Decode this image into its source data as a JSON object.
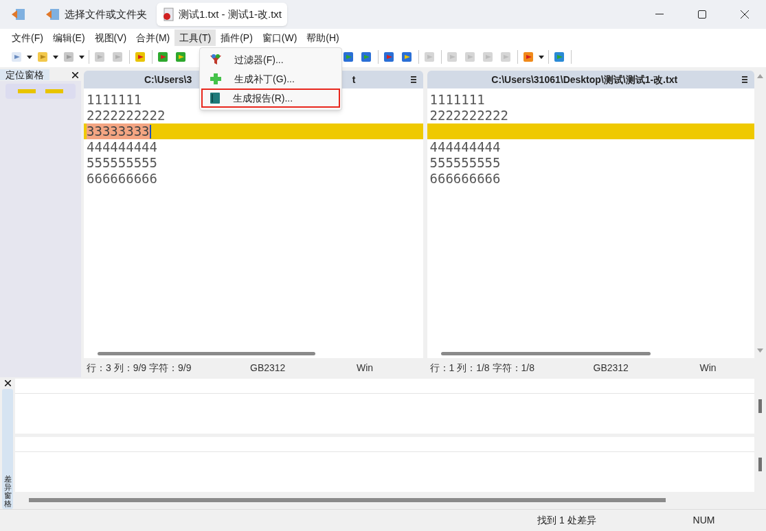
{
  "window": {
    "tabs": [
      {
        "label": "选择文件或文件夹",
        "selected": false
      },
      {
        "label": "测试1.txt - 测试1-改.txt",
        "selected": true
      }
    ]
  },
  "menu": [
    {
      "label": "文件(F)",
      "open": false
    },
    {
      "label": "编辑(E)",
      "open": false
    },
    {
      "label": "视图(V)",
      "open": false
    },
    {
      "label": "合并(M)",
      "open": false
    },
    {
      "label": "工具(T)",
      "open": true
    },
    {
      "label": "插件(P)",
      "open": false
    },
    {
      "label": "窗口(W)",
      "open": false
    },
    {
      "label": "帮助(H)",
      "open": false
    }
  ],
  "dropdown": {
    "items": [
      {
        "label": "过滤器(F)...",
        "kind": "filter",
        "marked": false
      },
      {
        "label": "生成补丁(G)...",
        "kind": "patch",
        "marked": false
      },
      {
        "label": "生成报告(R)...",
        "kind": "report",
        "marked": true
      }
    ]
  },
  "location_pane": {
    "title": "定位窗格"
  },
  "panes": [
    {
      "path": "C:\\Users\\3",
      "path_tail": "t",
      "lines": [
        {
          "text": "1111111",
          "diff": false
        },
        {
          "text": "2222222222",
          "diff": false
        },
        {
          "text": "33333333",
          "diff": true
        },
        {
          "text": "444444444",
          "diff": false
        },
        {
          "text": "555555555",
          "diff": false
        },
        {
          "text": "666666666",
          "diff": false
        }
      ],
      "status": {
        "position": "行：3 列：9/9 字符：9/9",
        "encoding": "GB2312",
        "eol": "Win"
      }
    },
    {
      "path": "C:\\Users\\31061\\Desktop\\测试\\测试1-改.txt",
      "lines": [
        {
          "text": "1111111",
          "diff": false
        },
        {
          "text": "2222222222",
          "diff": false
        },
        {
          "diff": true
        },
        {
          "text": "444444444",
          "diff": false
        },
        {
          "text": "555555555",
          "diff": false
        },
        {
          "text": "666666666",
          "diff": false
        }
      ],
      "status": {
        "position": "行：1 列：1/8 字符：1/8",
        "encoding": "GB2312",
        "eol": "Win"
      }
    }
  ],
  "diff_pane": {
    "title": "差异窗格"
  },
  "status_bar": {
    "message": "找到 1 处差异",
    "num": "NUM"
  }
}
